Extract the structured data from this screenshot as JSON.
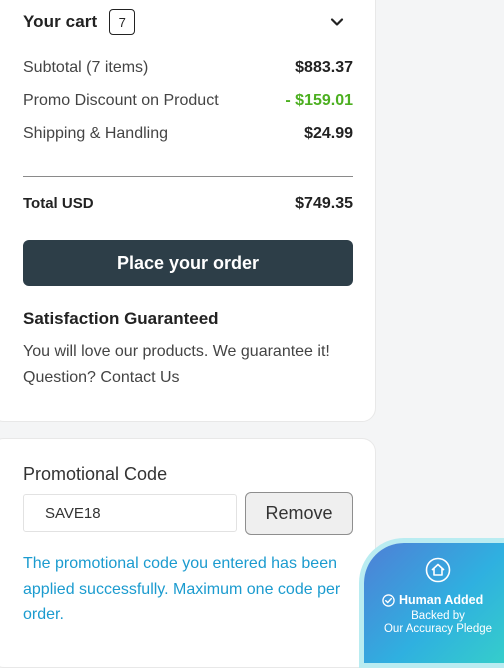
{
  "cart": {
    "title": "Your cart",
    "count": "7",
    "subtotal_label": "Subtotal (7 items)",
    "subtotal_value": "$883.37",
    "promo_label": "Promo Discount on Product",
    "promo_value": "- $159.01",
    "shipping_label": "Shipping & Handling",
    "shipping_value": "$24.99",
    "total_label": "Total USD",
    "total_value": "$749.35",
    "order_button": "Place your order",
    "satisfaction_title": "Satisfaction Guaranteed",
    "satisfaction_text": "You will love our products. We guarantee it!",
    "question_text": "Question?",
    "contact_link": "Contact Us",
    "collapse_icon": "chevron-down-icon"
  },
  "promo": {
    "title": "Promotional Code",
    "code_value": "SAVE18",
    "remove_button": "Remove",
    "message": "The promotional code you entered has been applied successfully. Maximum one code per order."
  },
  "badge": {
    "title": "Human Added",
    "line1": "Backed by",
    "line2": "Our Accuracy Pledge",
    "icons": [
      "house-icon",
      "check-circle-icon"
    ]
  },
  "colors": {
    "discount": "#4caf20",
    "order_button_bg": "#2d3e48",
    "message": "#1b9bcf",
    "badge_start": "#4f7fd6",
    "badge_end": "#36d0c9"
  }
}
